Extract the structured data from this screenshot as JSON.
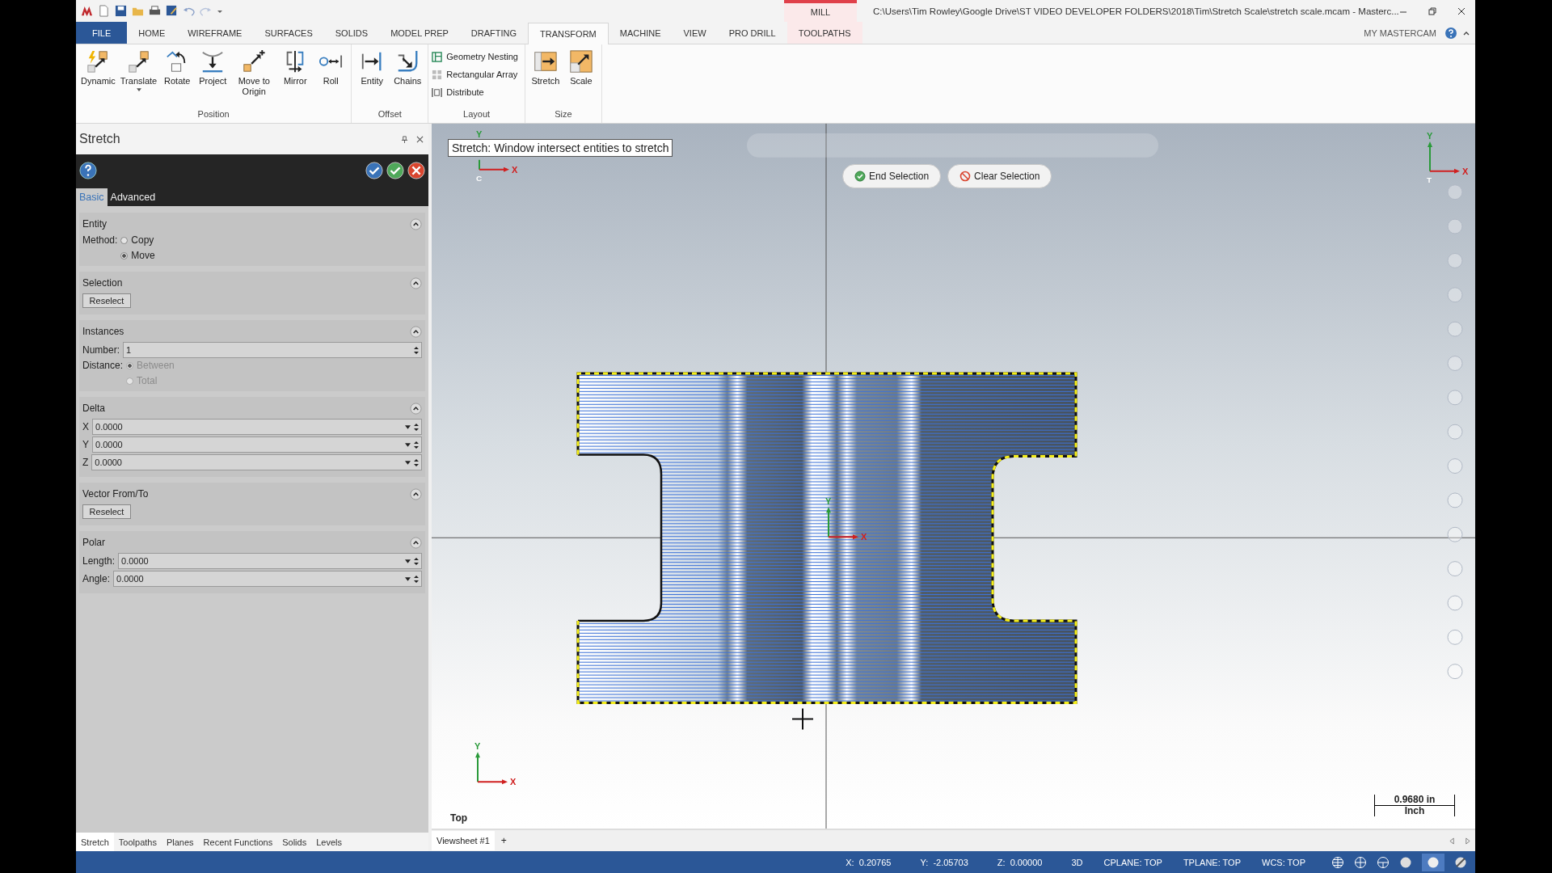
{
  "context_tab": {
    "label": "MILL"
  },
  "window_title": "C:\\Users\\Tim Rowley\\Google Drive\\ST VIDEO DEVELOPER FOLDERS\\2018\\Tim\\Stretch Scale\\stretch scale.mcam - Masterc...",
  "ribbon_tabs": [
    {
      "label": "FILE",
      "kind": "file",
      "selected": false
    },
    {
      "label": "HOME",
      "kind": "normal",
      "selected": false
    },
    {
      "label": "WIREFRAME",
      "kind": "normal",
      "selected": false
    },
    {
      "label": "SURFACES",
      "kind": "normal",
      "selected": false
    },
    {
      "label": "SOLIDS",
      "kind": "normal",
      "selected": false
    },
    {
      "label": "MODEL PREP",
      "kind": "normal",
      "selected": false
    },
    {
      "label": "DRAFTING",
      "kind": "normal",
      "selected": false
    },
    {
      "label": "TRANSFORM",
      "kind": "normal",
      "selected": true
    },
    {
      "label": "MACHINE",
      "kind": "normal",
      "selected": false
    },
    {
      "label": "VIEW",
      "kind": "normal",
      "selected": false
    },
    {
      "label": "PRO DRILL",
      "kind": "normal",
      "selected": false
    },
    {
      "label": "TOOLPATHS",
      "kind": "context",
      "selected": false
    }
  ],
  "my_mastercam": "MY MASTERCAM",
  "ribbon_groups": [
    {
      "label": "Position",
      "kind": "large",
      "buttons": [
        {
          "label": "Dynamic",
          "dropdown": false
        },
        {
          "label": "Translate",
          "dropdown": true
        },
        {
          "label": "Rotate",
          "dropdown": false
        },
        {
          "label": "Project",
          "dropdown": false
        },
        {
          "label": "Move to Origin",
          "dropdown": false
        },
        {
          "label": "Mirror",
          "dropdown": false
        },
        {
          "label": "Roll",
          "dropdown": false
        }
      ]
    },
    {
      "label": "Offset",
      "kind": "large",
      "buttons": [
        {
          "label": "Entity",
          "dropdown": false
        },
        {
          "label": "Chains",
          "dropdown": false
        }
      ]
    },
    {
      "label": "Layout",
      "kind": "small",
      "buttons": [
        {
          "label": "Geometry Nesting"
        },
        {
          "label": "Rectangular Array"
        },
        {
          "label": "Distribute"
        }
      ]
    },
    {
      "label": "Size",
      "kind": "large",
      "buttons": [
        {
          "label": "Stretch",
          "dropdown": false
        },
        {
          "label": "Scale",
          "dropdown": false
        }
      ]
    }
  ],
  "panel": {
    "title": "Stretch",
    "tabs": [
      {
        "label": "Basic",
        "selected": true
      },
      {
        "label": "Advanced",
        "selected": false
      }
    ],
    "sections": [
      {
        "title": "Entity",
        "expanded": true,
        "items": [
          {
            "kind": "radio",
            "label": "Method:",
            "disabled": false,
            "options": [
              {
                "label": "Copy",
                "selected": false
              },
              {
                "label": "Move",
                "selected": true
              }
            ]
          }
        ]
      },
      {
        "title": "Selection",
        "expanded": true,
        "items": [
          {
            "kind": "button",
            "label": "Reselect"
          }
        ]
      },
      {
        "title": "Instances",
        "expanded": true,
        "items": [
          {
            "kind": "spin",
            "label": "Number:",
            "value": "1"
          },
          {
            "kind": "radio",
            "label": "Distance:",
            "disabled": true,
            "options": [
              {
                "label": "Between",
                "selected": true
              },
              {
                "label": "Total",
                "selected": false
              }
            ]
          }
        ]
      },
      {
        "title": "Delta",
        "expanded": true,
        "items": [
          {
            "kind": "combo",
            "label": "X",
            "value": "0.0000"
          },
          {
            "kind": "combo",
            "label": "Y",
            "value": "0.0000"
          },
          {
            "kind": "combo",
            "label": "Z",
            "value": "0.0000"
          }
        ]
      },
      {
        "title": "Vector From/To",
        "expanded": true,
        "items": [
          {
            "kind": "button",
            "label": "Reselect"
          }
        ]
      },
      {
        "title": "Polar",
        "expanded": true,
        "items": [
          {
            "kind": "combo",
            "label": "Length:",
            "value": "0.0000"
          },
          {
            "kind": "combo",
            "label": "Angle:",
            "value": "0.0000"
          }
        ]
      }
    ]
  },
  "bottom_tabs": [
    {
      "label": "Stretch",
      "selected": true
    },
    {
      "label": "Toolpaths",
      "selected": false
    },
    {
      "label": "Planes",
      "selected": false
    },
    {
      "label": "Recent Functions",
      "selected": false
    },
    {
      "label": "Solids",
      "selected": false
    },
    {
      "label": "Levels",
      "selected": false
    }
  ],
  "viewport": {
    "prompt": "Stretch:  Window intersect entities to stretch",
    "buttons": [
      {
        "label": "End Selection",
        "kind": "end"
      },
      {
        "label": "Clear Selection",
        "kind": "clear"
      }
    ],
    "view_name": "Top",
    "scale": {
      "value": "0.9680 in",
      "unit": "Inch"
    },
    "gnomons": [
      {
        "kind": "corner",
        "x": "X",
        "y": "Y",
        "plane": "C"
      },
      {
        "kind": "corner-right",
        "x": "X",
        "y": "Y",
        "plane": "T"
      },
      {
        "kind": "origin",
        "x": "X",
        "y": "Y"
      },
      {
        "kind": "bottom",
        "x": "X",
        "y": "Y"
      }
    ]
  },
  "viewsheet_tabs": [
    {
      "label": "Viewsheet #1",
      "selected": true
    }
  ],
  "viewsheet_add": "+",
  "status_bar": {
    "coords": [
      {
        "label": "X:",
        "value": "0.20765"
      },
      {
        "label": "Y:",
        "value": "-2.05703"
      },
      {
        "label": "Z:",
        "value": "0.00000"
      }
    ],
    "modes": [
      "3D",
      "CPLANE: TOP",
      "TPLANE: TOP",
      "WCS: TOP"
    ]
  }
}
